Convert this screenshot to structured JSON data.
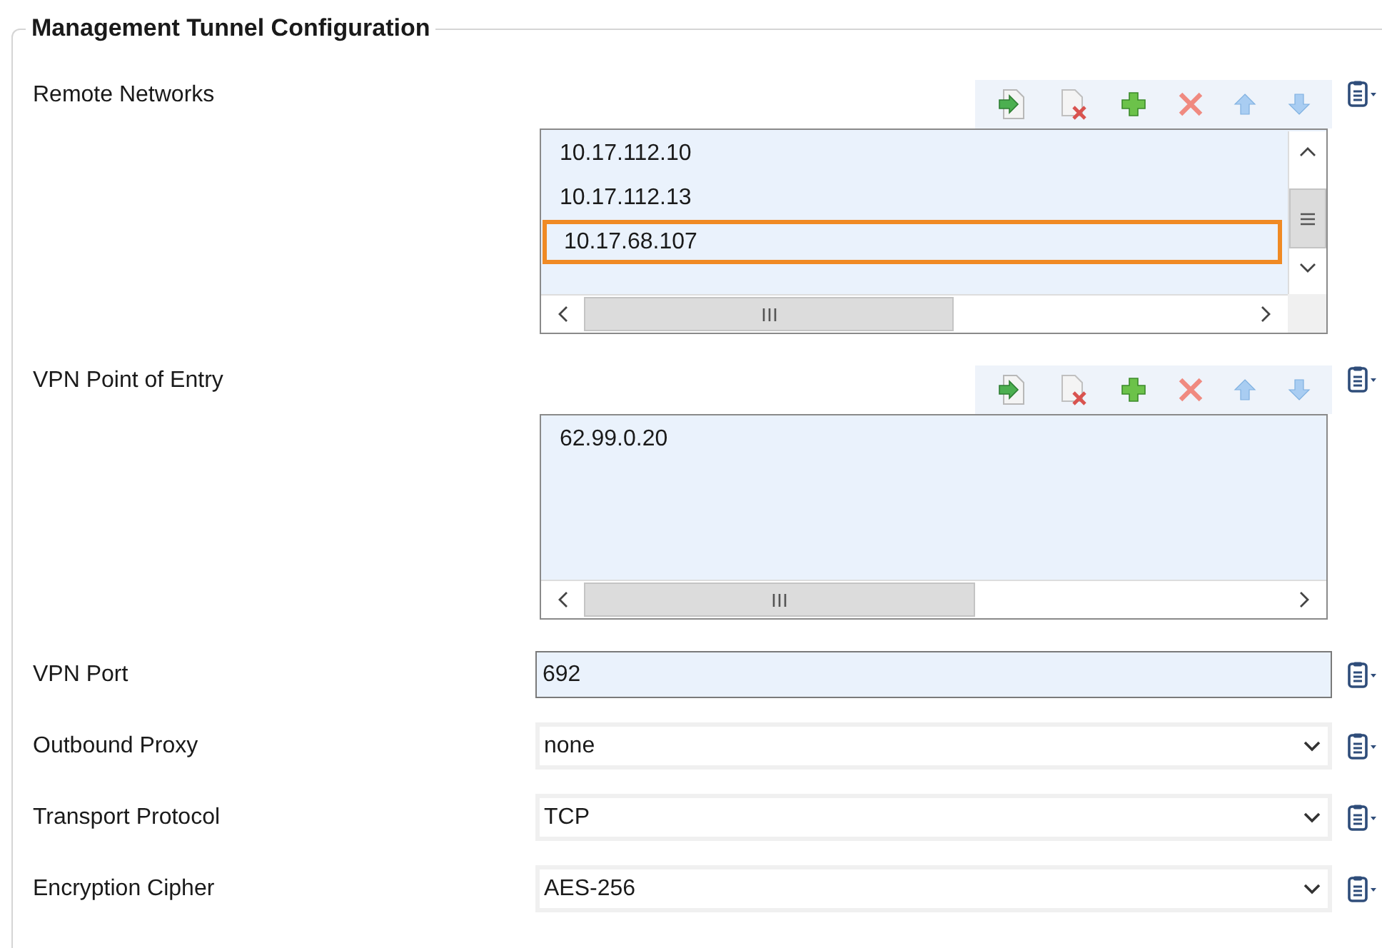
{
  "title": "Management Tunnel Configuration",
  "fields": [
    {
      "kind": "list",
      "label": "Remote Networks",
      "items": [
        {
          "text": "10.17.112.10",
          "selected": false
        },
        {
          "text": "10.17.112.13",
          "selected": false
        },
        {
          "text": "10.17.68.107",
          "selected": true
        }
      ]
    },
    {
      "kind": "list",
      "label": "VPN Point of Entry",
      "items": [
        {
          "text": "62.99.0.20",
          "selected": false
        }
      ]
    },
    {
      "kind": "text",
      "label": "VPN Port",
      "value": "692"
    },
    {
      "kind": "select",
      "label": "Outbound Proxy",
      "value": "none"
    },
    {
      "kind": "select",
      "label": "Transport Protocol",
      "value": "TCP"
    },
    {
      "kind": "select",
      "label": "Encryption Cipher",
      "value": "AES-256"
    }
  ]
}
